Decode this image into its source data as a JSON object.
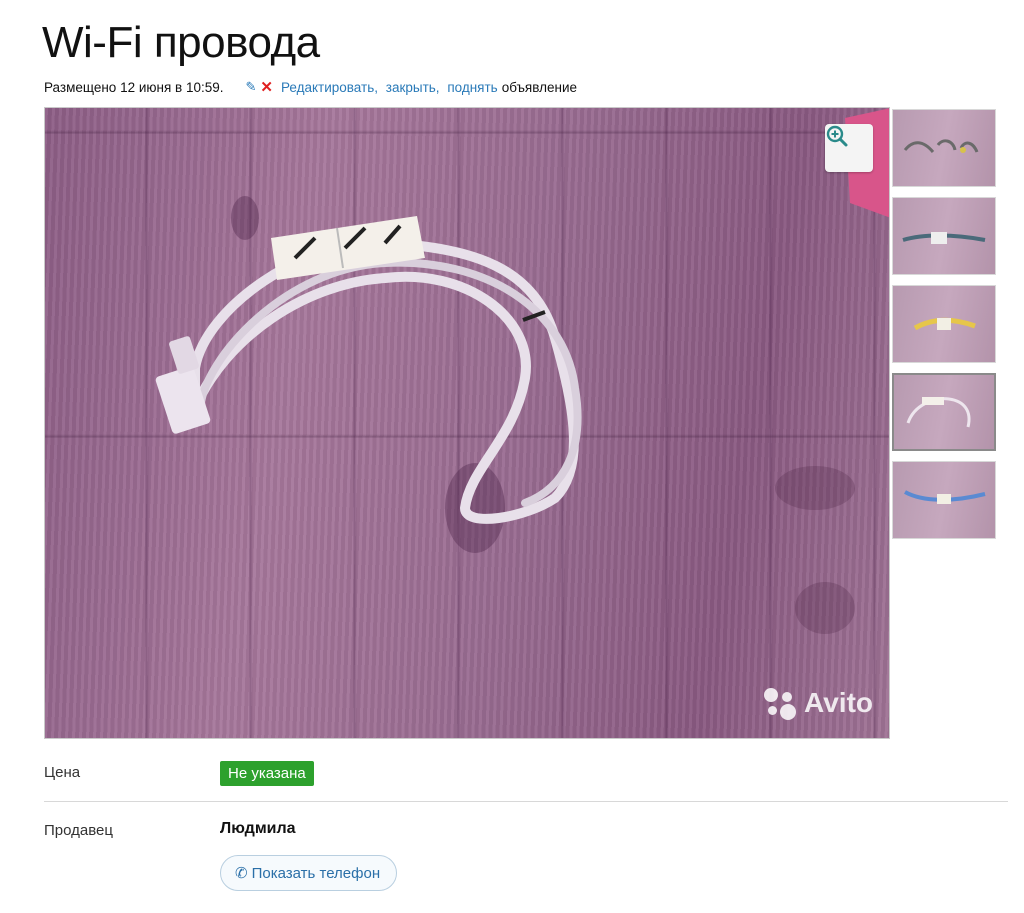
{
  "listing": {
    "title": "Wi-Fi провода",
    "posted": "Размещено 12 июня в 10:59.",
    "actions": {
      "edit": "Редактировать",
      "close": "закрыть",
      "raise": "поднять",
      "tail": "объявление"
    }
  },
  "gallery": {
    "watermark": "Avito",
    "zoom_icon": "zoom-in-icon",
    "thumbnail_count": 5,
    "active_thumbnail": 4
  },
  "details": {
    "price_label": "Цена",
    "price_value": "Не указана",
    "seller_label": "Продавец",
    "seller_name": "Людмила",
    "phone_button": "Показать телефон"
  },
  "colors": {
    "accent_link": "#2a7ab8",
    "price_badge": "#2da12d",
    "delete_x": "#e02020"
  }
}
